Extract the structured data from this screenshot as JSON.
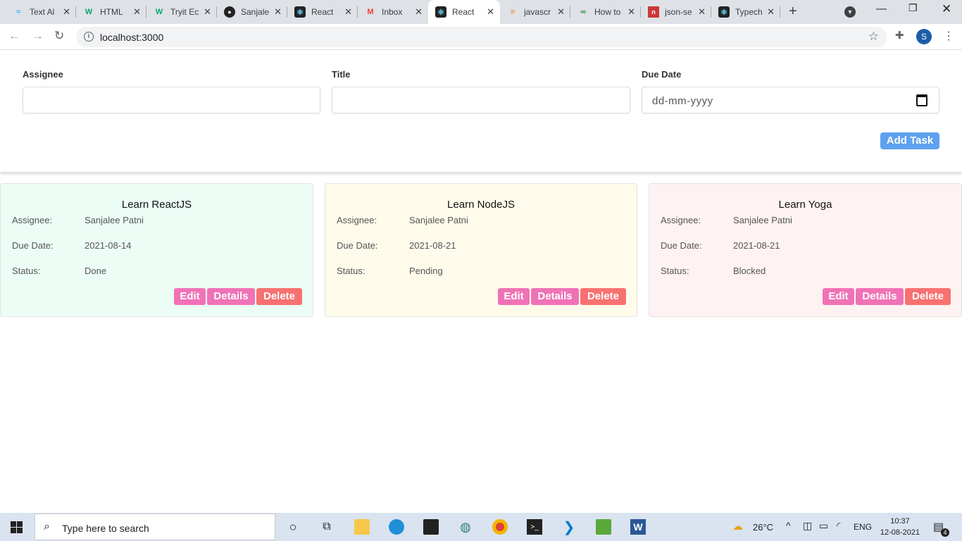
{
  "browser": {
    "tabs": [
      {
        "label": "Text Al",
        "icon": "tailwind-icon",
        "active": false
      },
      {
        "label": "HTML",
        "icon": "w3-icon",
        "active": false
      },
      {
        "label": "Tryit Ec",
        "icon": "w3-icon",
        "active": false
      },
      {
        "label": "Sanjale",
        "icon": "github-icon",
        "active": false
      },
      {
        "label": "React",
        "icon": "react-icon",
        "active": false
      },
      {
        "label": "Inbox",
        "icon": "gmail-icon",
        "active": false
      },
      {
        "label": "React",
        "icon": "react-icon",
        "active": true
      },
      {
        "label": "javascr",
        "icon": "stackoverflow-icon",
        "active": false
      },
      {
        "label": "How to",
        "icon": "gfg-icon",
        "active": false
      },
      {
        "label": "json-se",
        "icon": "npm-icon",
        "active": false
      },
      {
        "label": "Typech",
        "icon": "react-icon",
        "active": false
      }
    ],
    "url": "localhost:3000",
    "profile_initial": "S"
  },
  "form": {
    "assignee_label": "Assignee",
    "title_label": "Title",
    "due_date_label": "Due Date",
    "due_date_placeholder": "dd-mm-yyyy",
    "add_button": "Add Task"
  },
  "labels": {
    "assignee": "Assignee:",
    "due_date": "Due Date:",
    "status": "Status:",
    "edit": "Edit",
    "details": "Details",
    "delete": "Delete"
  },
  "tasks": [
    {
      "title": "Learn ReactJS",
      "assignee": "Sanjalee Patni",
      "due_date": "2021-08-14",
      "status": "Done",
      "color": "#ecfdf5"
    },
    {
      "title": "Learn NodeJS",
      "assignee": "Sanjalee Patni",
      "due_date": "2021-08-21",
      "status": "Pending",
      "color": "#fffbeb"
    },
    {
      "title": "Learn Yoga",
      "assignee": "Sanjalee Patni",
      "due_date": "2021-08-21",
      "status": "Blocked",
      "color": "#fef2f2"
    }
  ],
  "colors": {
    "edit": "#f072b6",
    "details": "#f072b6",
    "delete": "#f87171",
    "add": "#5ea1ee"
  },
  "taskbar": {
    "search_placeholder": "Type here to search",
    "weather": "26°C",
    "language": "ENG",
    "time": "10:37",
    "date": "12-08-2021",
    "notifications": "4"
  }
}
